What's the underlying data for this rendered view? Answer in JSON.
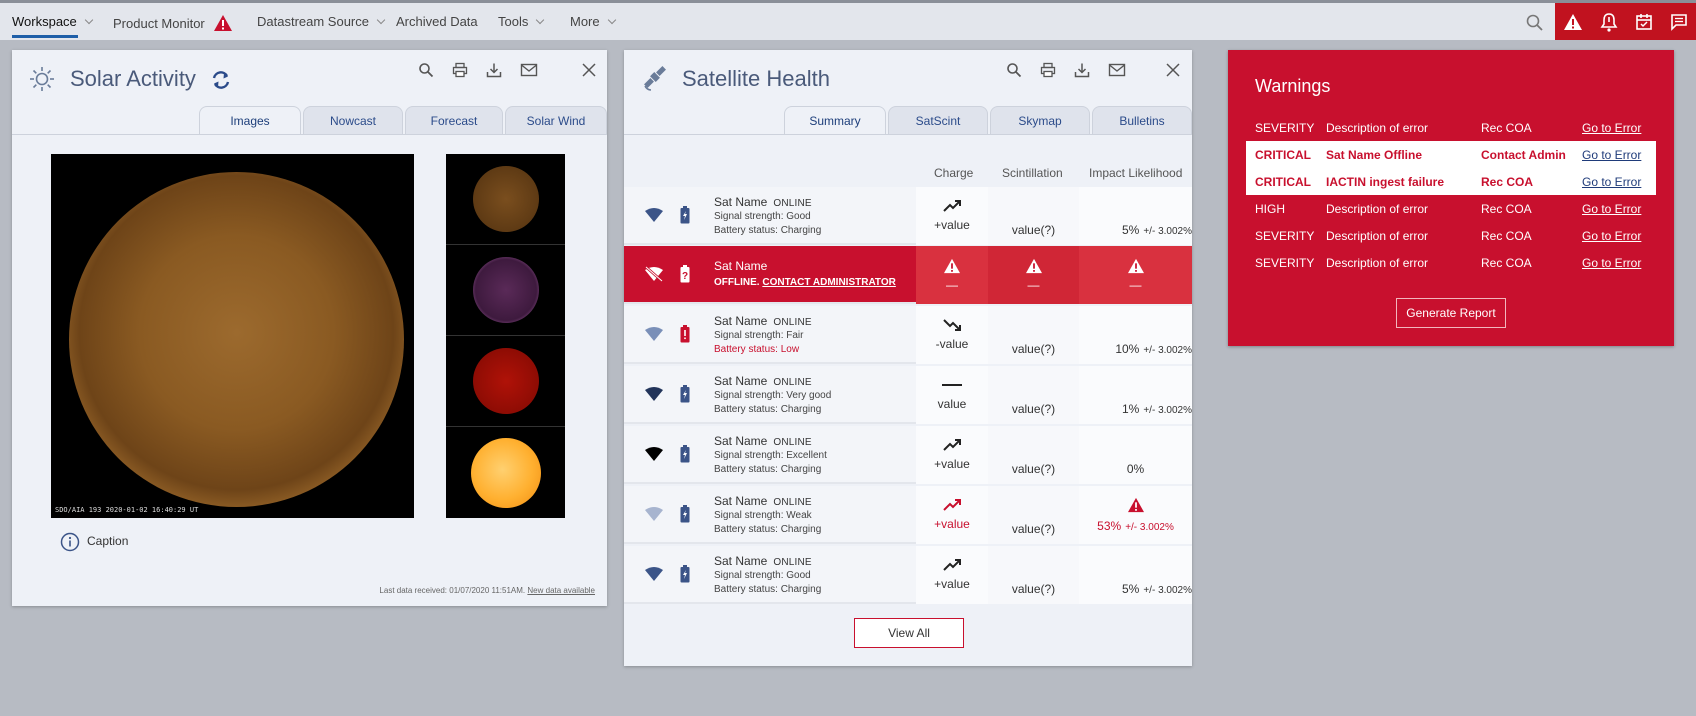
{
  "nav": {
    "items": [
      {
        "label": "Workspace"
      },
      {
        "label": "Product Monitor"
      },
      {
        "label": "Datastream Source"
      },
      {
        "label": "Archived Data"
      },
      {
        "label": "Tools"
      },
      {
        "label": "More"
      }
    ]
  },
  "solar": {
    "title": "Solar Activity",
    "tabs": [
      "Images",
      "Nowcast",
      "Forecast",
      "Solar Wind"
    ],
    "image_caption": "SDO/AIA  193    2020-01-02 16:40:29 UT",
    "caption": "Caption",
    "last_data": "Last data received: 01/07/2020 11:51AM.",
    "new_data_link": "New data available"
  },
  "satellite": {
    "title": "Satellite Health",
    "tabs": [
      "Summary",
      "SatScint",
      "Skymap",
      "Bulletins"
    ],
    "headers": {
      "charge": "Charge",
      "scint": "Scintillation",
      "impact": "Impact Likelihood"
    },
    "rows": [
      {
        "name": "Sat Name",
        "status": "ONLINE",
        "signal": "Signal strength: Good",
        "battery": "Battery status: Charging",
        "charge": "+value",
        "scint": "value(?)",
        "impact": "5%",
        "pm": "+/- 3.002%"
      },
      {
        "name": "Sat Name",
        "status": "OFFLINE.",
        "contact": "CONTACT ADMINISTRATOR",
        "charge": "—",
        "scint": "—",
        "impact": "—"
      },
      {
        "name": "Sat Name",
        "status": "ONLINE",
        "signal": "Signal strength: Fair",
        "battery": "Battery status: Low",
        "charge": "-value",
        "scint": "value(?)",
        "impact": "10%",
        "pm": "+/- 3.002%"
      },
      {
        "name": "Sat Name",
        "status": "ONLINE",
        "signal": "Signal strength: Very good",
        "battery": "Battery status: Charging",
        "charge": "value",
        "scint": "value(?)",
        "impact": "1%",
        "pm": "+/- 3.002%"
      },
      {
        "name": "Sat Name",
        "status": "ONLINE",
        "signal": "Signal strength: Excellent",
        "battery": "Battery status: Charging",
        "charge": "+value",
        "scint": "value(?)",
        "impact": "0%"
      },
      {
        "name": "Sat Name",
        "status": "ONLINE",
        "signal": "Signal strength: Weak",
        "battery": "Battery status: Charging",
        "charge": "+value",
        "scint": "value(?)",
        "impact": "53%",
        "pm": "+/- 3.002%"
      },
      {
        "name": "Sat Name",
        "status": "ONLINE",
        "signal": "Signal strength: Good",
        "battery": "Battery status: Charging",
        "charge": "+value",
        "scint": "value(?)",
        "impact": "5%",
        "pm": "+/- 3.002%"
      }
    ],
    "view_all": "View All"
  },
  "warnings": {
    "title": "Warnings",
    "rows": [
      {
        "severity": "SEVERITY",
        "desc": "Description of error",
        "action": "Rec COA",
        "link": "Go to Error"
      },
      {
        "severity": "CRITICAL",
        "desc": "Sat Name Offline",
        "action": "Contact Admin",
        "link": "Go to Error"
      },
      {
        "severity": "CRITICAL",
        "desc": "IACTIN ingest failure",
        "action": "Rec COA",
        "link": "Go to Error"
      },
      {
        "severity": "HIGH",
        "desc": "Description of error",
        "action": "Rec COA",
        "link": "Go to Error"
      },
      {
        "severity": "SEVERITY",
        "desc": "Description of error",
        "action": "Rec COA",
        "link": "Go to Error"
      },
      {
        "severity": "SEVERITY",
        "desc": "Description of error",
        "action": "Rec COA",
        "link": "Go to Error"
      }
    ],
    "generate": "Generate Report"
  },
  "colors": {
    "accent": "#c8102e",
    "nav_active": "#1f5fa8",
    "panel": "#eef1f7"
  }
}
